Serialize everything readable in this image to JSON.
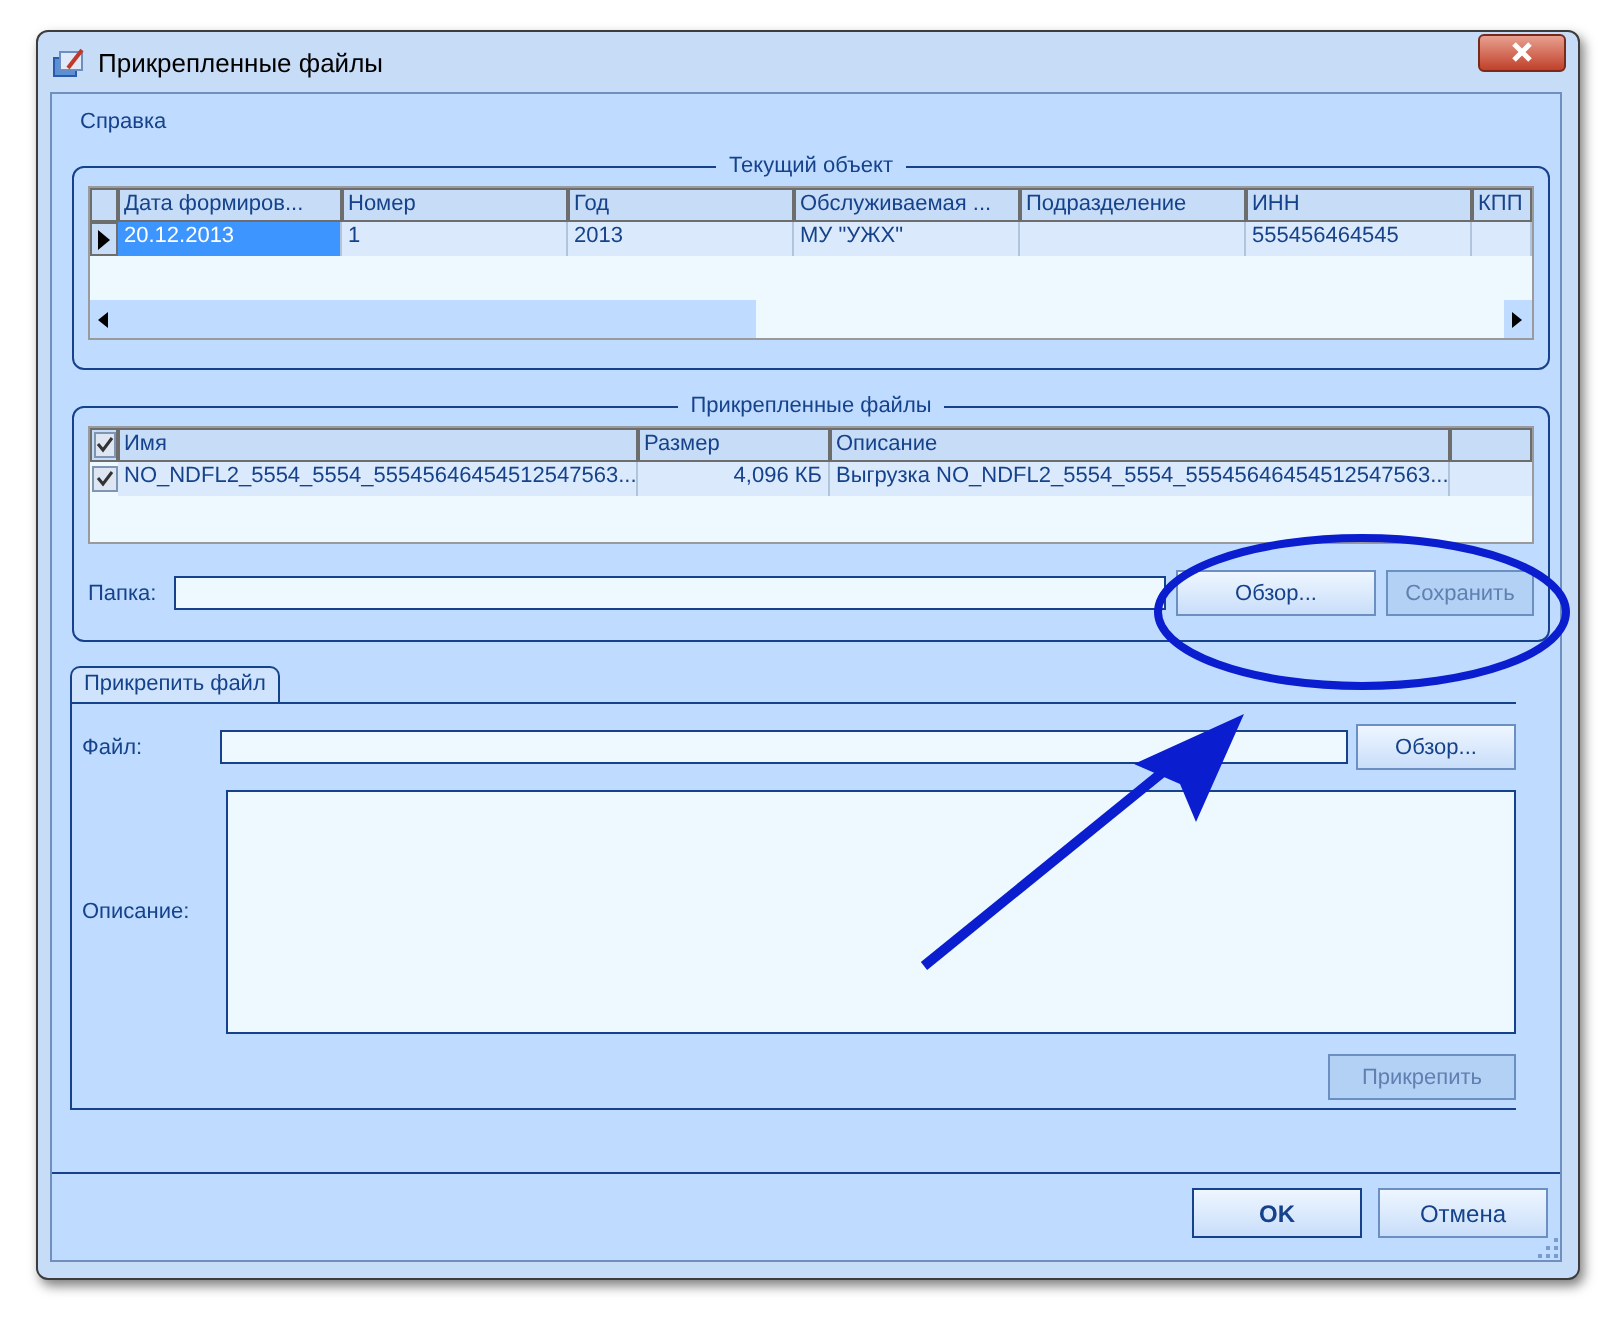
{
  "window": {
    "title": "Прикрепленные файлы"
  },
  "menu": [
    "Справка"
  ],
  "current_object": {
    "title": "Текущий объект",
    "columns": [
      "Дата формиров...",
      "Номер",
      "Год",
      "Обслуживаемая ...",
      "Подразделение",
      "ИНН",
      "КПП"
    ],
    "rows": [
      {
        "selected": true,
        "cells": [
          "20.12.2013",
          "1",
          "2013",
          "МУ \"УЖХ\"",
          null,
          "555456464545",
          null
        ]
      }
    ]
  },
  "attached_files": {
    "title": "Прикрепленные файлы",
    "header_checked": true,
    "columns": [
      "Имя",
      "Размер",
      "Описание"
    ],
    "rows": [
      {
        "checked": true,
        "cells": [
          "NO_NDFL2_5554_5554_55545646454512547563...",
          "4,096 КБ",
          "Выгрузка NO_NDFL2_5554_5554_55545646454512547563..."
        ]
      }
    ],
    "folder_label": "Папка:",
    "browse": "Обзор...",
    "save": {
      "label": "Сохранить",
      "disabled": true
    }
  },
  "attach_tab": {
    "tab": {
      "label": "Прикрепить файл",
      "selected": true
    },
    "file_label": "Файл:",
    "browse": "Обзор...",
    "description_label": "Описание:",
    "attach": {
      "label": "Прикрепить",
      "disabled": true
    }
  },
  "buttons": [
    {
      "label": "OK",
      "default": true
    },
    {
      "label": "Отмена",
      "default": false
    }
  ]
}
